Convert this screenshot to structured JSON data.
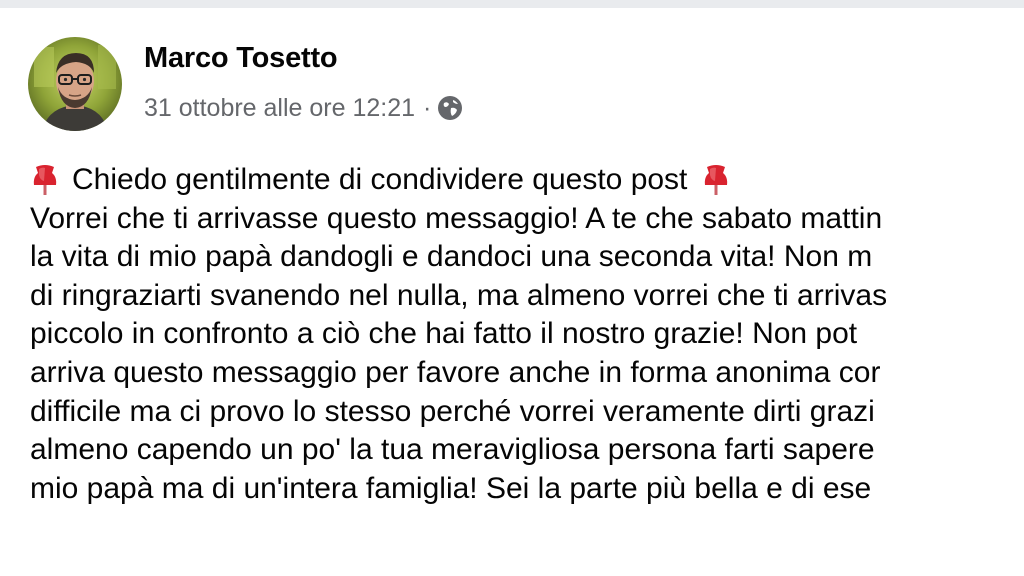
{
  "post": {
    "author": {
      "name": "Marco Tosetto",
      "avatar": "profile-photo"
    },
    "meta": {
      "timestamp": "31 ottobre alle ore 12:21",
      "separator": "·",
      "audience_icon": "globe-icon"
    },
    "icons": {
      "lead": "red-pushpin-icon",
      "trail": "red-pushpin-icon",
      "pin_color": "#d9232f"
    },
    "lines": [
      "Chiedo gentilmente di condividere questo post",
      "Vorrei che ti arrivasse questo messaggio! A te che sabato mattin",
      "la vita di mio papà dandogli e dandoci una seconda vita! Non m",
      "di ringraziarti svanendo nel nulla, ma almeno vorrei che ti arrivas",
      "piccolo in confronto a ciò che hai fatto il nostro grazie! Non pot",
      "arriva questo messaggio per favore anche in forma anonima cor",
      "difficile ma ci provo lo stesso perché vorrei veramente dirti grazi",
      "almeno capendo un po' la tua meravigliosa persona farti sapere",
      "mio papà ma di un'intera famiglia! Sei la parte più bella e di ese"
    ]
  },
  "colors": {
    "name_text": "#050505",
    "meta_text": "#65676b",
    "background": "#ffffff"
  }
}
